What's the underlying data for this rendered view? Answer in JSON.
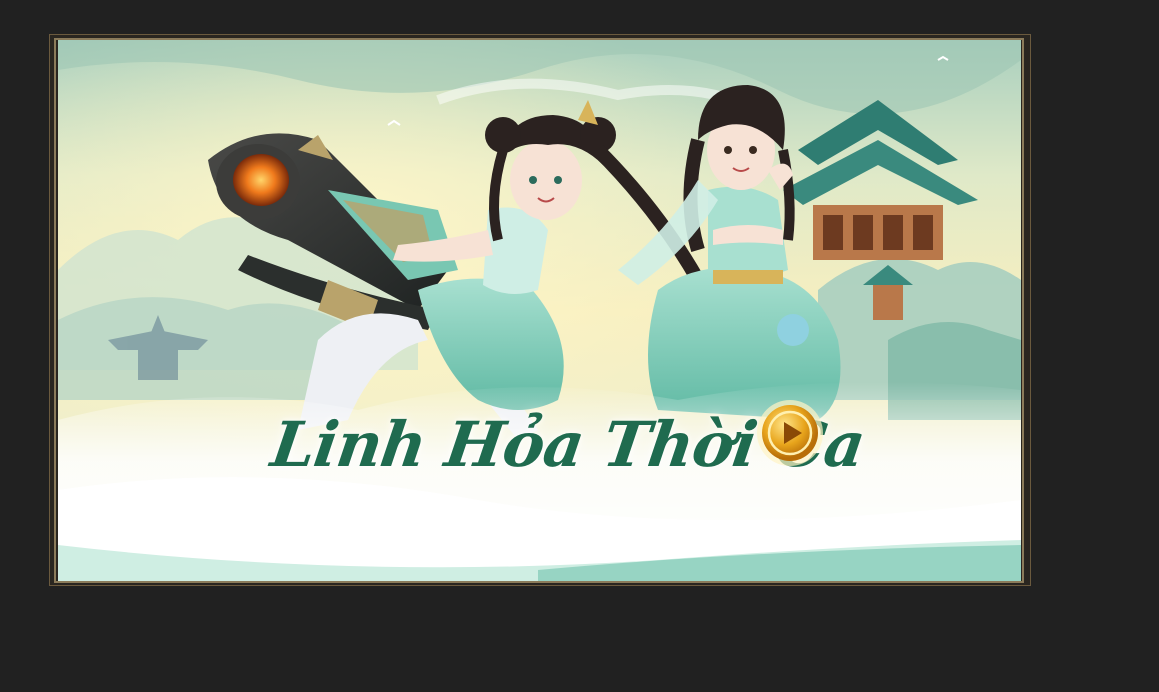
{
  "banner": {
    "title": "Linh Hỏa Thời Ca",
    "colors": {
      "title": "#1f6b4f",
      "sky_top": "#bcd8c8",
      "sky_glow": "#fbf1bf",
      "jade": "#7fc9b5",
      "gold": "#e0a21e"
    }
  },
  "icons": {
    "play": "play-icon"
  }
}
